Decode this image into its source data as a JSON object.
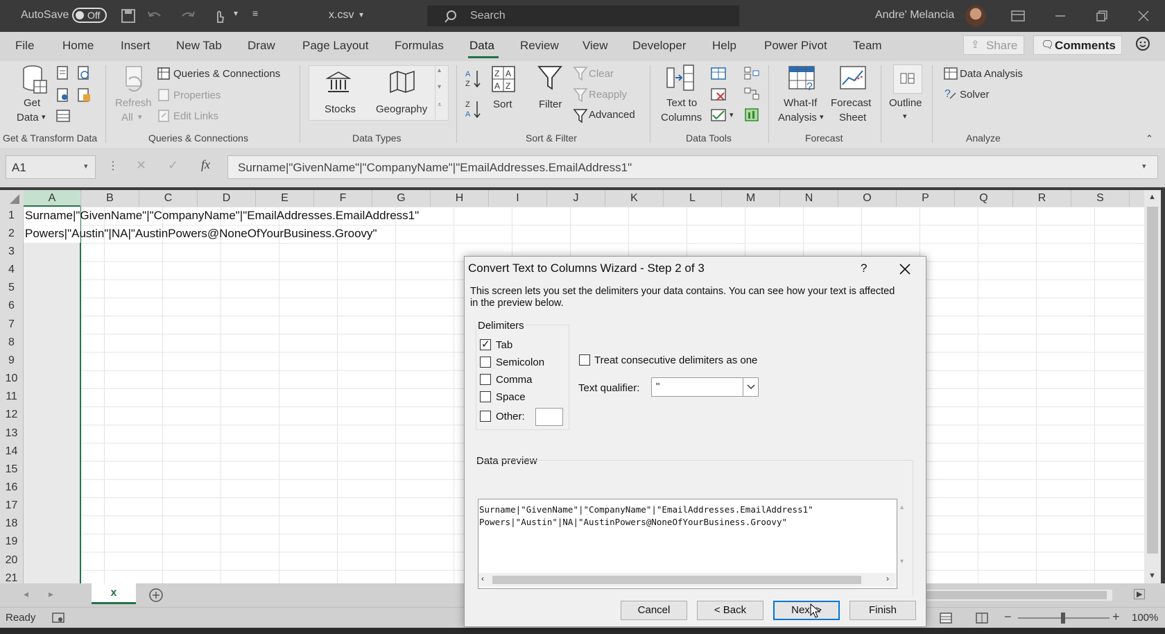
{
  "titlebar": {
    "autosave_label": "AutoSave",
    "autosave_state": "Off",
    "filename": "x.csv",
    "search_placeholder": "Search",
    "user_name": "Andre' Melancia"
  },
  "ribbon": {
    "tabs": [
      "File",
      "Home",
      "Insert",
      "New Tab",
      "Draw",
      "Page Layout",
      "Formulas",
      "Data",
      "Review",
      "View",
      "Developer",
      "Help",
      "Power Pivot",
      "Team"
    ],
    "active_tab": "Data",
    "share_label": "Share",
    "comments_label": "Comments",
    "get_data_line1": "Get",
    "get_data_line2": "Data",
    "refresh_line1": "Refresh",
    "refresh_line2": "All",
    "queries_connections": "Queries & Connections",
    "properties": "Properties",
    "edit_links": "Edit Links",
    "stocks": "Stocks",
    "geography": "Geography",
    "sort": "Sort",
    "filter": "Filter",
    "clear": "Clear",
    "reapply": "Reapply",
    "advanced": "Advanced",
    "text_to_columns_line1": "Text to",
    "text_to_columns_line2": "Columns",
    "what_if_line1": "What-If",
    "what_if_line2": "Analysis",
    "forecast_sheet_line1": "Forecast",
    "forecast_sheet_line2": "Sheet",
    "outline": "Outline",
    "data_analysis": "Data Analysis",
    "solver": "Solver",
    "groups": {
      "get_transform": "Get & Transform Data",
      "queries": "Queries & Connections",
      "data_types": "Data Types",
      "sort_filter": "Sort & Filter",
      "data_tools": "Data Tools",
      "forecast": "Forecast",
      "analyze": "Analyze"
    }
  },
  "formula_bar": {
    "name_box": "A1",
    "content": "Surname|\"GivenName\"|\"CompanyName\"|\"EmailAddresses.EmailAddress1\""
  },
  "grid": {
    "columns": [
      "A",
      "B",
      "C",
      "D",
      "E",
      "F",
      "G",
      "H",
      "I",
      "J",
      "K",
      "L",
      "M",
      "N",
      "O",
      "P",
      "Q",
      "R",
      "S"
    ],
    "rows": [
      "1",
      "2",
      "3",
      "4",
      "5",
      "6",
      "7",
      "8",
      "9",
      "10",
      "11",
      "12",
      "13",
      "14",
      "15",
      "16",
      "17",
      "18",
      "19",
      "20",
      "21"
    ],
    "cell_a1": "Surname|\"GivenName\"|\"CompanyName\"|\"EmailAddresses.EmailAddress1\"",
    "cell_a2": "Powers|\"Austin\"|NA|\"AustinPowers@NoneOfYourBusiness.Groovy\""
  },
  "sheet_tab": "x",
  "status": {
    "ready": "Ready",
    "zoom": "100%"
  },
  "dialog": {
    "title": "Convert Text to Columns Wizard - Step 2 of 3",
    "help": "?",
    "intro_line1": "This screen lets you set the delimiters your data contains.  You can see how your text is affected",
    "intro_line2": "in the preview below.",
    "delimiters_label": "Delimiters",
    "tab": "Tab",
    "semicolon": "Semicolon",
    "comma": "Comma",
    "space": "Space",
    "other": "Other:",
    "tab_checked": true,
    "treat_consecutive": "Treat consecutive delimiters as one",
    "text_qualifier_label": "Text qualifier:",
    "text_qualifier_value": "\"",
    "data_preview_label": "Data preview",
    "preview_line1": "Surname|\"GivenName\"|\"CompanyName\"|\"EmailAddresses.EmailAddress1\"",
    "preview_line2": "Powers|\"Austin\"|NA|\"AustinPowers@NoneOfYourBusiness.Groovy\"",
    "cancel": "Cancel",
    "back": "< Back",
    "next": "Next >",
    "finish": "Finish"
  }
}
